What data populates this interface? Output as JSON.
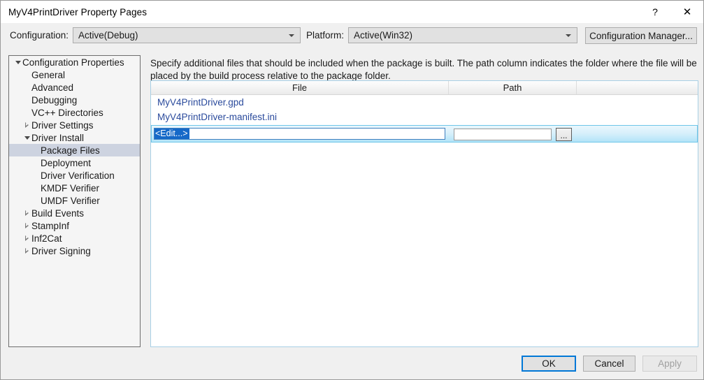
{
  "window": {
    "title": "MyV4PrintDriver Property Pages",
    "help_icon": "question-mark-icon",
    "close_icon": "close-icon",
    "help_label": "?",
    "close_label": "✕"
  },
  "config_bar": {
    "configuration_label": "Configuration:",
    "configuration_value": "Active(Debug)",
    "platform_label": "Platform:",
    "platform_value": "Active(Win32)",
    "config_manager_label": "Configuration Manager..."
  },
  "tree": {
    "items": [
      {
        "label": "Configuration Properties",
        "indent": 0,
        "state": "expanded",
        "selected": false
      },
      {
        "label": "General",
        "indent": 1,
        "state": "leaf",
        "selected": false
      },
      {
        "label": "Advanced",
        "indent": 1,
        "state": "leaf",
        "selected": false
      },
      {
        "label": "Debugging",
        "indent": 1,
        "state": "leaf",
        "selected": false
      },
      {
        "label": "VC++ Directories",
        "indent": 1,
        "state": "leaf",
        "selected": false
      },
      {
        "label": "Driver Settings",
        "indent": 1,
        "state": "collapsed",
        "selected": false
      },
      {
        "label": "Driver Install",
        "indent": 1,
        "state": "expanded",
        "selected": false
      },
      {
        "label": "Package Files",
        "indent": 2,
        "state": "leaf",
        "selected": true
      },
      {
        "label": "Deployment",
        "indent": 2,
        "state": "leaf",
        "selected": false
      },
      {
        "label": "Driver Verification",
        "indent": 2,
        "state": "leaf",
        "selected": false
      },
      {
        "label": "KMDF Verifier",
        "indent": 2,
        "state": "leaf",
        "selected": false
      },
      {
        "label": "UMDF Verifier",
        "indent": 2,
        "state": "leaf",
        "selected": false
      },
      {
        "label": "Build Events",
        "indent": 1,
        "state": "collapsed",
        "selected": false
      },
      {
        "label": "StampInf",
        "indent": 1,
        "state": "collapsed",
        "selected": false
      },
      {
        "label": "Inf2Cat",
        "indent": 1,
        "state": "collapsed",
        "selected": false
      },
      {
        "label": "Driver Signing",
        "indent": 1,
        "state": "collapsed",
        "selected": false
      }
    ]
  },
  "main": {
    "description": "Specify additional files that should be included when the package is built.  The path column indicates the folder where the file will be placed by the build process relative to the package folder.",
    "grid": {
      "columns": [
        "File",
        "Path",
        ""
      ],
      "rows": [
        {
          "file": "MyV4PrintDriver.gpd",
          "path": ""
        },
        {
          "file": "MyV4PrintDriver-manifest.ini",
          "path": ""
        }
      ],
      "edit_row": {
        "file_value": "<Edit...>",
        "path_value": "",
        "browse_label": "...",
        "browse_icon": "ellipsis-icon"
      }
    }
  },
  "footer": {
    "ok_label": "OK",
    "cancel_label": "Cancel",
    "apply_label": "Apply"
  },
  "colors": {
    "accent": "#0078d7",
    "link": "#2a4a9c",
    "selection": "#1669c8",
    "tree_selected": "#cdd3e0",
    "edit_row_border": "#6ec6e8"
  }
}
